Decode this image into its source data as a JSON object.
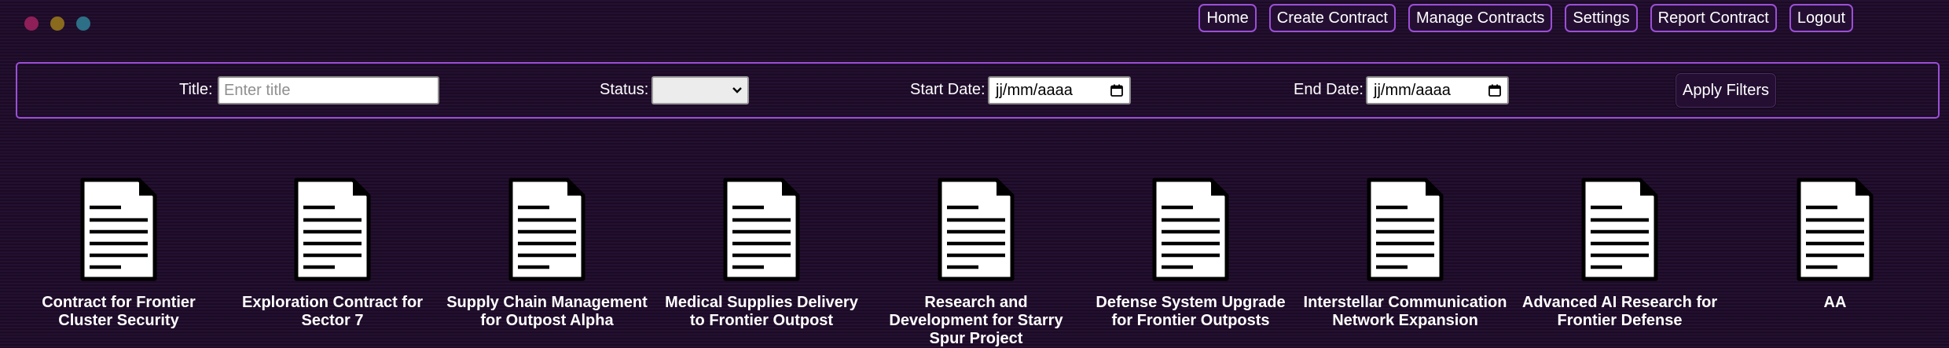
{
  "window": {
    "controls": [
      {
        "name": "close",
        "color": "#8e1f59"
      },
      {
        "name": "minimize",
        "color": "#8a6a1c"
      },
      {
        "name": "maximize",
        "color": "#2d6f86"
      }
    ]
  },
  "nav": {
    "items": [
      {
        "label": "Home"
      },
      {
        "label": "Create Contract"
      },
      {
        "label": "Manage Contracts"
      },
      {
        "label": "Settings"
      },
      {
        "label": "Report Contract"
      },
      {
        "label": "Logout"
      }
    ]
  },
  "filters": {
    "title_label": "Title:",
    "title_placeholder": "Enter title",
    "title_value": "",
    "status_label": "Status:",
    "status_value": "",
    "start_label": "Start Date:",
    "start_value": "jj/mm/aaaa",
    "end_label": "End Date:",
    "end_value": "jj/mm/aaaa",
    "apply_label": "Apply Filters"
  },
  "contracts": [
    {
      "title": "Contract for Frontier Cluster Security",
      "icon": "document-icon"
    },
    {
      "title": "Exploration Contract for Sector 7",
      "icon": "document-icon"
    },
    {
      "title": "Supply Chain Management for Outpost Alpha",
      "icon": "document-icon"
    },
    {
      "title": "Medical Supplies Delivery to Frontier Outpost",
      "icon": "document-icon"
    },
    {
      "title": "Research and Development for Starry Spur Project",
      "icon": "document-icon"
    },
    {
      "title": "Defense System Upgrade for Frontier Outposts",
      "icon": "document-icon"
    },
    {
      "title": "Interstellar Communication Network Expansion",
      "icon": "document-icon"
    },
    {
      "title": "Advanced AI Research for Frontier Defense",
      "icon": "document-icon"
    },
    {
      "title": "AA",
      "icon": "document-icon"
    }
  ],
  "colors": {
    "accent_border": "#9b4fd6",
    "background": "#1f0d2a",
    "button_bg": "#240f33"
  }
}
